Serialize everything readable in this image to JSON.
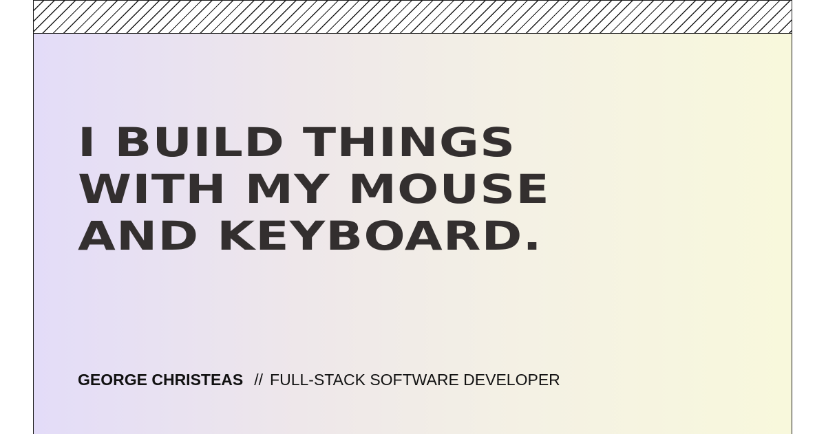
{
  "hero": {
    "headline_lines": [
      "I BUILD THINGS",
      "WITH MY MOUSE",
      "AND KEYBOARD."
    ],
    "name": "GEORGE CHRISTEAS",
    "separator": "//",
    "role": "FULL-STACK SOFTWARE DEVELOPER"
  },
  "colors": {
    "text": "#332f2f",
    "gradient_start": "#e3dcf8",
    "gradient_end": "#f8f8dc",
    "stripe": "#1a1a1a"
  }
}
